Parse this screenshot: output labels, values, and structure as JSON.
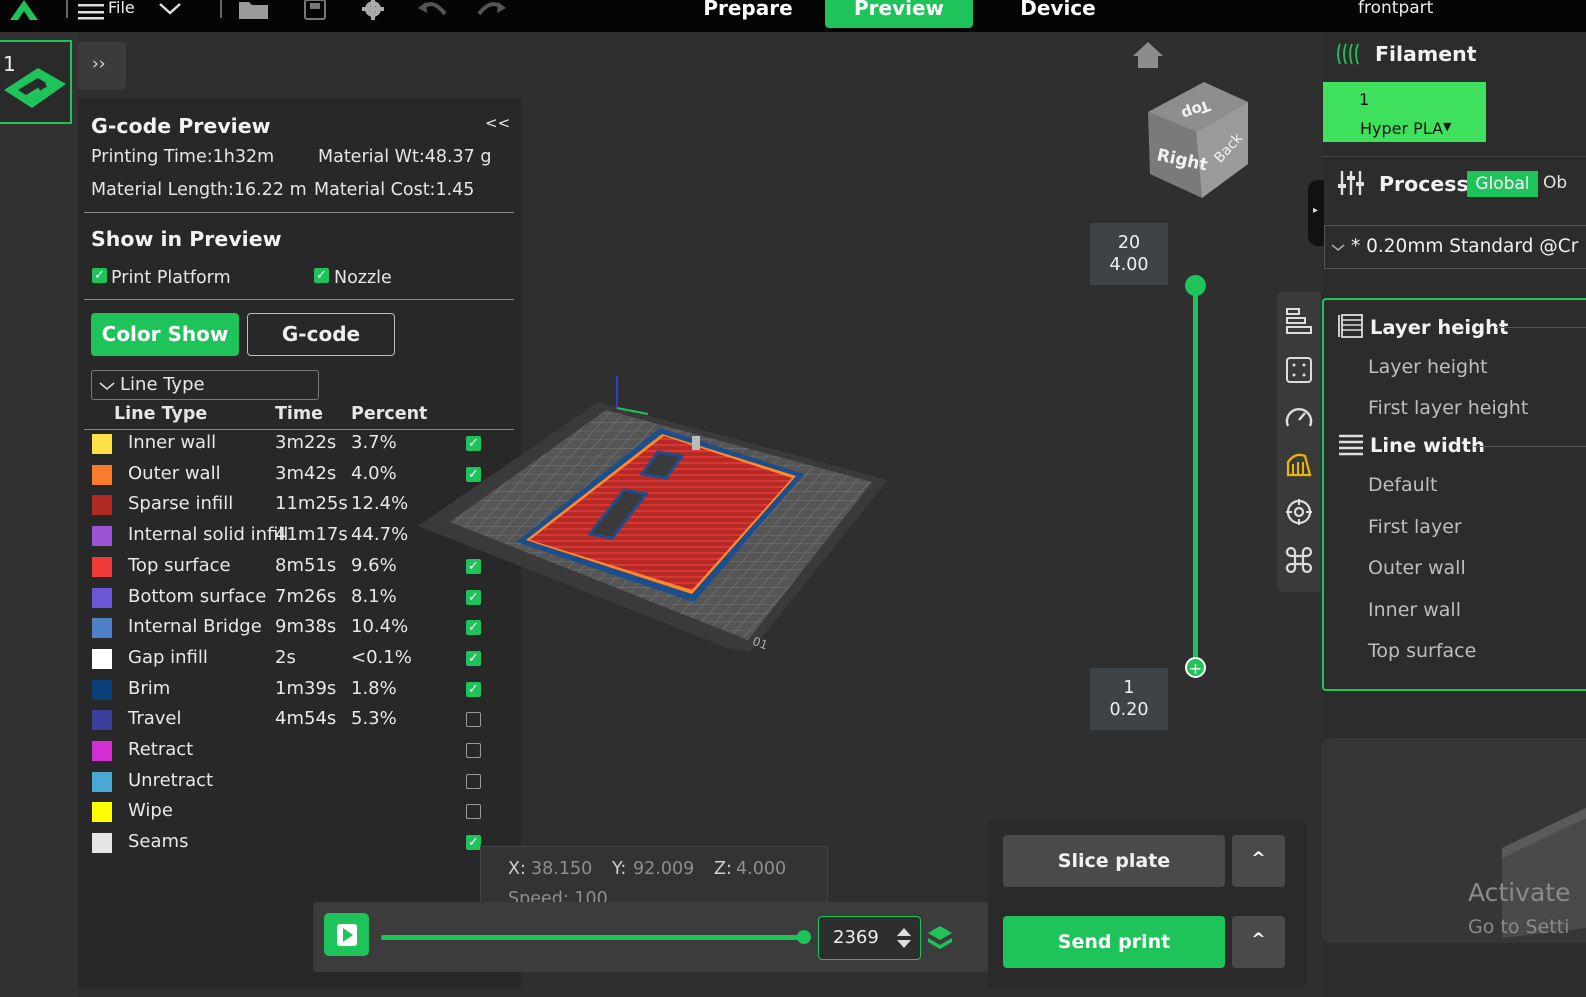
{
  "topbar": {
    "file_label": "File",
    "tabs": [
      {
        "label": "Prepare"
      },
      {
        "label": "Preview"
      },
      {
        "label": "Device"
      }
    ],
    "project_name": "frontpart"
  },
  "plate": {
    "number": "1"
  },
  "expand_sidebar": "››",
  "gcode_preview": {
    "title": "G-code Preview",
    "collapse_label": "<<",
    "printing_time": "Printing Time:1h32m",
    "material_wt": "Material Wt:48.37 g",
    "material_length": "Material Length:16.22 m",
    "material_cost": "Material Cost:1.45",
    "show_title": "Show in Preview",
    "print_platform": "Print Platform",
    "nozzle": "Nozzle",
    "color_show": "Color Show",
    "gcode": "G-code",
    "dropdown_value": "Line Type",
    "columns": {
      "type": "Line Type",
      "time": "Time",
      "percent": "Percent"
    },
    "rows": [
      {
        "color": "#fde047",
        "name": "Inner wall",
        "time": "3m22s",
        "percent": "3.7%",
        "checked": true
      },
      {
        "color": "#fb7b2c",
        "name": "Outer wall",
        "time": "3m42s",
        "percent": "4.0%",
        "checked": true
      },
      {
        "color": "#b02a24",
        "name": "Sparse infill",
        "time": "11m25s",
        "percent": "12.4%",
        "checked": true
      },
      {
        "color": "#9b55d4",
        "name": "Internal solid infill",
        "time": "41m17s",
        "percent": "44.7%",
        "checked": true
      },
      {
        "color": "#f03a3a",
        "name": "Top surface",
        "time": "8m51s",
        "percent": "9.6%",
        "checked": true
      },
      {
        "color": "#6a57d6",
        "name": "Bottom surface",
        "time": "7m26s",
        "percent": "8.1%",
        "checked": true
      },
      {
        "color": "#4f80c8",
        "name": "Internal Bridge",
        "time": "9m38s",
        "percent": "10.4%",
        "checked": true
      },
      {
        "color": "#ffffff",
        "name": "Gap infill",
        "time": "2s",
        "percent": "<0.1%",
        "checked": true
      },
      {
        "color": "#0b3f7a",
        "name": "Brim",
        "time": "1m39s",
        "percent": "1.8%",
        "checked": true
      },
      {
        "color": "#3a3f9c",
        "name": "Travel",
        "time": "4m54s",
        "percent": "5.3%",
        "checked": false
      },
      {
        "color": "#d42fd4",
        "name": "Retract",
        "time": "",
        "percent": "",
        "checked": false
      },
      {
        "color": "#4aa8d6",
        "name": "Unretract",
        "time": "",
        "percent": "",
        "checked": false
      },
      {
        "color": "#ffff00",
        "name": "Wipe",
        "time": "",
        "percent": "",
        "checked": false
      },
      {
        "color": "#e6e6e6",
        "name": "Seams",
        "time": "",
        "percent": "",
        "checked": true
      }
    ]
  },
  "viewport": {
    "cube": {
      "top": "Top",
      "right": "Right",
      "back": "Back"
    },
    "layer_top": {
      "layer": "20",
      "height": "4.00"
    },
    "layer_bottom": {
      "layer": "1",
      "height": "0.20"
    },
    "coords": {
      "x_label": "X:",
      "x": "38.150",
      "y_label": "Y:",
      "y": "92.009",
      "z_label": "Z:",
      "z": "4.000",
      "speed": "Speed: 100"
    },
    "move_value": "2369",
    "slice_plate": "Slice plate",
    "send_print": "Send print",
    "caret": "^"
  },
  "right": {
    "filament_title": "Filament",
    "filament_slot": "1",
    "filament_name": "Hyper PLA",
    "process_title": "Process",
    "global": "Global",
    "object": "Ob",
    "preset": "* 0.20mm Standard @Cr",
    "layer_height_head": "Layer height",
    "layer_items": [
      "Layer height",
      "First layer height"
    ],
    "line_width_head": "Line width",
    "line_items": [
      "Default",
      "First layer",
      "Outer wall",
      "Inner wall",
      "Top surface"
    ],
    "watermark_1": "Activate",
    "watermark_2": "Go to Setti"
  },
  "colors": {
    "accent": "#1ec45a",
    "panel": "#282828",
    "topbar": "#050505"
  }
}
